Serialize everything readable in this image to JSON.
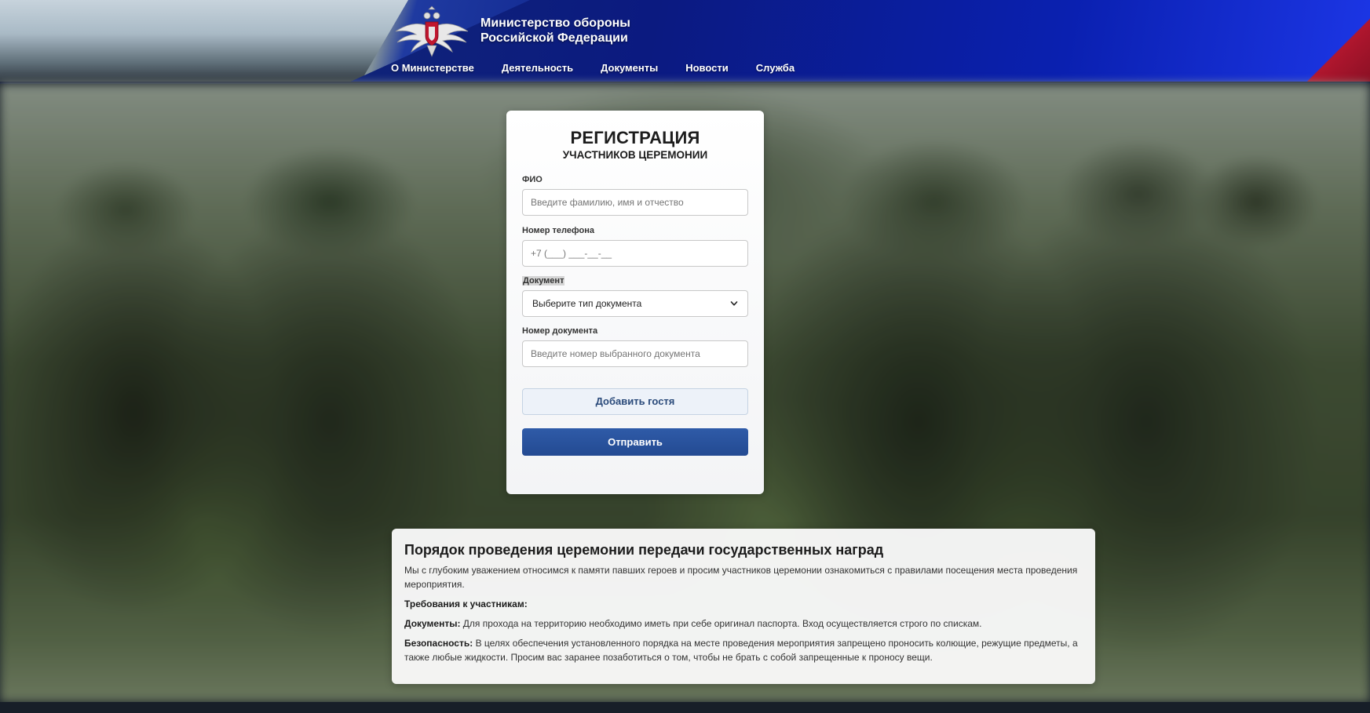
{
  "header": {
    "brand_line1": "Министерство обороны",
    "brand_line2": "Российской Федерации",
    "emblem_icon": "double-headed-eagle-emblem-icon",
    "nav": [
      {
        "label": "О Министерстве"
      },
      {
        "label": "Деятельность"
      },
      {
        "label": "Документы"
      },
      {
        "label": "Новости"
      },
      {
        "label": "Служба"
      }
    ],
    "colors": {
      "blue": "#0a1f8a",
      "red": "#b0162e"
    }
  },
  "form": {
    "title": "РЕГИСТРАЦИЯ",
    "subtitle": "УЧАСТНИКОВ ЦЕРЕМОНИИ",
    "fio_label": "ФИО",
    "fio_placeholder": "Введите фамилию, имя и отчество",
    "phone_label": "Номер телефона",
    "phone_placeholder": "+7 (___) ___-__-__",
    "document_label": "Документ",
    "document_selected": "Выберите тип документа",
    "docnum_label": "Номер документа",
    "docnum_placeholder": "Введите номер выбранного документа",
    "add_guest_label": "Добавить гостя",
    "submit_label": "Отправить",
    "submit_color": "#2f5ba8"
  },
  "info": {
    "title": "Порядок проведения церемонии передачи государственных наград",
    "intro": "Мы с глубоким уважением относимся к памяти павших героев и просим участников церемонии ознакомиться с правилами посещения места проведения мероприятия.",
    "requirements_heading": "Требования к участникам:",
    "documents_label": "Документы:",
    "documents_text": " Для прохода на территорию необходимо иметь при себе оригинал паспорта. Вход осуществляется строго по спискам.",
    "security_label": "Безопасность:",
    "security_text": " В целях обеспечения установленного порядка на месте проведения мероприятия запрещено проносить колющие, режущие предметы, а также любые жидкости. Просим вас заранее позаботиться о том, чтобы не брать с собой запрещенные к проносу вещи."
  }
}
